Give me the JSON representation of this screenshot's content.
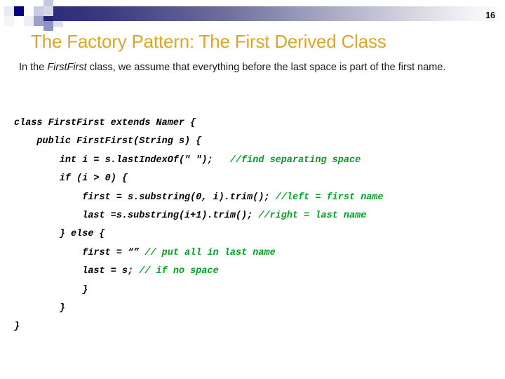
{
  "slide": {
    "number": "16",
    "title": "The Factory Pattern: The First Derived Class",
    "intro": {
      "before": "In the ",
      "emphasis": "FirstFirst",
      "after": " class, we assume that everything before the last space is part of the first name."
    },
    "colors": {
      "title": "#D9A629",
      "comment_green": "#00A31E",
      "band_dark": "#2A2A78",
      "accent_navy": "#000080",
      "code_text": "#000000"
    },
    "code": {
      "language": "java",
      "lines": [
        {
          "indent": 0,
          "code": "class FirstFirst extends Namer {",
          "comment": ""
        },
        {
          "indent": 1,
          "code": "public FirstFirst(String s) {",
          "comment": ""
        },
        {
          "indent": 2,
          "code": "int i = s.lastIndexOf(\" \");",
          "gap": "   ",
          "comment": "//find separating space"
        },
        {
          "indent": 2,
          "code": "if (i > 0) {",
          "comment": ""
        },
        {
          "indent": 3,
          "code": "first = s.substring(0, i).trim();",
          "gap": " ",
          "comment": "//left = first name"
        },
        {
          "indent": 3,
          "code": "last =s.substring(i+1).trim();",
          "gap": " ",
          "comment": "//right = last name"
        },
        {
          "indent": 2,
          "code": "} else {",
          "comment": ""
        },
        {
          "indent": 3,
          "code": "first = “”",
          "gap": " ",
          "comment": "// put all in last name"
        },
        {
          "indent": 3,
          "code": "last = s;",
          "gap": " ",
          "comment": "// if no space"
        },
        {
          "indent": 3,
          "code": "}",
          "comment": ""
        },
        {
          "indent": 2,
          "code": "}",
          "comment": ""
        },
        {
          "indent": 0,
          "code": "}",
          "comment": ""
        }
      ]
    }
  }
}
